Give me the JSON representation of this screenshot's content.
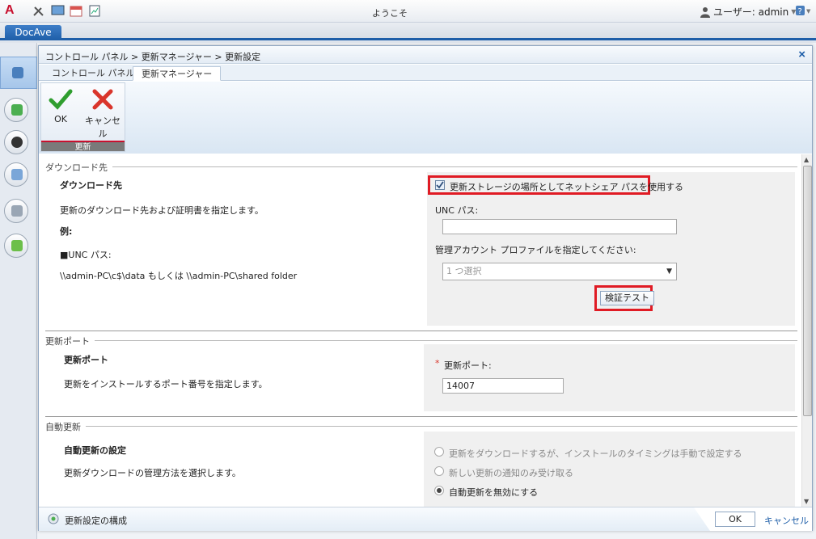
{
  "topbar": {
    "welcome": "ようこそ",
    "user_label": "ユーザー: admin"
  },
  "app_tab": "DocAve",
  "dialog": {
    "breadcrumb": "コントロール パネル > 更新マネージャー > 更新設定",
    "tabs": [
      {
        "label": "コントロール パネル"
      },
      {
        "label": "更新マネージャー"
      }
    ],
    "ribbon": {
      "ok": "OK",
      "cancel": "キャンセル",
      "group": "更新"
    },
    "download": {
      "section": "ダウンロード先",
      "title": "ダウンロード先",
      "desc": "更新のダウンロード先および証明書を指定します。",
      "example": "例:",
      "unc_bullet": "■UNC パス:",
      "unc_example": "\\\\admin-PC\\c$\\data もしくは \\\\admin-PC\\shared folder",
      "use_share_label": "更新ストレージの場所としてネットシェア パスを使用する",
      "use_share_checked": true,
      "unc_label": "UNC パス:",
      "unc_value": "",
      "account_label": "管理アカウント プロファイルを指定してください:",
      "account_value": "1 つ選択",
      "test_button": "検証テスト"
    },
    "port": {
      "section": "更新ポート",
      "title": "更新ポート",
      "desc": "更新をインストールするポート番号を指定します。",
      "required_mark": "*",
      "port_label": "更新ポート:",
      "port_value": "14007"
    },
    "auto": {
      "section": "自動更新",
      "title": "自動更新の設定",
      "desc": "更新ダウンロードの管理方法を選択します。",
      "options": [
        {
          "label": "更新をダウンロードするが、インストールのタイミングは手動で設定する",
          "selected": false
        },
        {
          "label": "新しい更新の通知のみ受け取る",
          "selected": false
        },
        {
          "label": "自動更新を無効にする",
          "selected": true
        }
      ]
    },
    "footer": {
      "status": "更新設定の構成",
      "ok": "OK",
      "cancel": "キャンセル"
    }
  },
  "colors": {
    "accent": "#1e5ea8",
    "highlight": "#e01b24"
  }
}
